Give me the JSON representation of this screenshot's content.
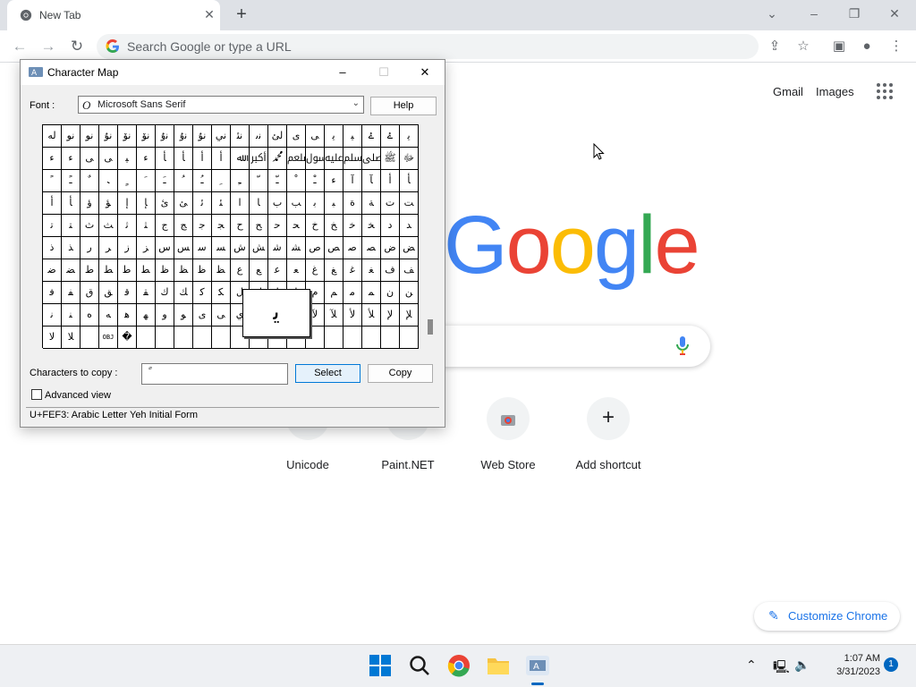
{
  "browser": {
    "tab_title": "New Tab",
    "omnibox_placeholder": "Search Google or type a URL"
  },
  "ntp": {
    "links": [
      "Gmail",
      "Images"
    ],
    "logo_text": "Google",
    "shortcuts": [
      {
        "label": "Unicode"
      },
      {
        "label": "Paint.NET"
      },
      {
        "label": "Web Store"
      },
      {
        "label": "Add shortcut"
      }
    ],
    "customize_label": "Customize Chrome"
  },
  "charmap": {
    "title": "Character Map",
    "font_label": "Font :",
    "font_value": "Microsoft Sans Serif",
    "help_label": "Help",
    "copy_label": "Characters to copy :",
    "copy_value": "ً",
    "select_label": "Select",
    "copy_button_label": "Copy",
    "advanced_label": "Advanced view",
    "status_text": "U+FEF3: Arabic Letter Yeh Initial Form",
    "zoomed_char": "ﯾ",
    "rows": [
      [
        "ﻟﻪ",
        "ﻧﻮ",
        "ﻧﻮ",
        "ﻧﯘ",
        "ﻧﯚ",
        "ﻧﯚ",
        "ﻧﯗ",
        "ﻧﯗ",
        "ﻧﯘ",
        "ﻧﻲ",
        "ﻧﺌ",
        "ﻧﯨ",
        "ﻟﺊ",
        "ﯼ",
        "ﯽ",
        "ﯾ",
        "ﯿ",
        "ۓ",
        "ۓ",
        "ﯾ"
      ],
      [
        "ﺀ",
        "ﺀ",
        "ﯽ",
        "ﯽ",
        "ﯿ",
        "ﺀ",
        "ﺄ",
        "ﺄ",
        "ﺃ",
        "ﺃ",
        "ﷲ",
        "ﷳ",
        "ﷴ",
        "ﷵ",
        "ﷶ",
        "ﷷ",
        "ﷸ",
        "ﷹ",
        "ﷺ",
        "ﷻ"
      ],
      [
        "ﹰ",
        "ﹱ",
        "ﹲ",
        "ﹳ",
        "ﹴ",
        "ﹶ",
        "ﹷ",
        "ﹸ",
        "ﹹ",
        "ﹺ",
        "ﹻ",
        "ﹼ",
        "ﹽ",
        "ﹾ",
        "ﹿ",
        "ﺀ",
        "ﺁ",
        "ﺂ",
        "ﺃ",
        "ﺄ"
      ],
      [
        "ﺃ",
        "ﺄ",
        "ﺅ",
        "ﺆ",
        "ﺇ",
        "ﺈ",
        "ﺉ",
        "ﺊ",
        "ﺋ",
        "ﺌ",
        "ﺍ",
        "ﺎ",
        "ﺏ",
        "ﺐ",
        "ﺑ",
        "ﺒ",
        "ﺓ",
        "ﺔ",
        "ﺕ",
        "ﺖ"
      ],
      [
        "ﺗ",
        "ﺘ",
        "ﺙ",
        "ﺚ",
        "ﺛ",
        "ﺜ",
        "ﺝ",
        "ﺞ",
        "ﺟ",
        "ﺠ",
        "ﺡ",
        "ﺢ",
        "ﺣ",
        "ﺤ",
        "ﺥ",
        "ﺦ",
        "ﺧ",
        "ﺨ",
        "ﺩ",
        "ﺪ"
      ],
      [
        "ﺫ",
        "ﺬ",
        "ﺭ",
        "ﺮ",
        "ﺯ",
        "ﺰ",
        "ﺱ",
        "ﺲ",
        "ﺳ",
        "ﺴ",
        "ﺵ",
        "ﺶ",
        "ﺷ",
        "ﺸ",
        "ﺹ",
        "ﺺ",
        "ﺻ",
        "ﺼ",
        "ﺽ",
        "ﺾ"
      ],
      [
        "ﺿ",
        "ﻀ",
        "ﻁ",
        "ﻂ",
        "ﻃ",
        "ﻄ",
        "ﻅ",
        "ﻆ",
        "ﻇ",
        "ﻈ",
        "ﻉ",
        "ﻊ",
        "ﻋ",
        "ﻌ",
        "ﻍ",
        "ﻎ",
        "ﻏ",
        "ﻐ",
        "ﻑ",
        "ﻒ"
      ],
      [
        "ﻓ",
        "ﻔ",
        "ﻕ",
        "ﻖ",
        "ﻗ",
        "ﻘ",
        "ﻙ",
        "ﻚ",
        "ﻛ",
        "ﻜ",
        "ﻝ",
        "ﻞ",
        "ﻟ",
        "ﻠ",
        "ﻡ",
        "ﻢ",
        "ﻣ",
        "ﻤ",
        "ﻥ",
        "ﻦ"
      ],
      [
        "ﻧ",
        "ﻨ",
        "ﻩ",
        "ﻪ",
        "ﻫ",
        "ﻬ",
        "ﻭ",
        "ﻮ",
        "ﻯ",
        "ﻰ",
        "ﻱ",
        "ﻲ",
        "ﻳ",
        "ﻴ",
        "ﻵ",
        "ﻶ",
        "ﻷ",
        "ﻸ",
        "ﻹ",
        "ﻺ"
      ],
      [
        "ﻻ",
        "ﻼ",
        "",
        "OBJ",
        "�",
        "",
        "",
        "",
        "",
        "",
        "",
        "",
        "",
        "",
        "",
        "",
        "",
        "",
        "",
        ""
      ]
    ]
  },
  "taskbar": {
    "time": "1:07 AM",
    "date": "3/31/2023",
    "notification_count": "1"
  }
}
